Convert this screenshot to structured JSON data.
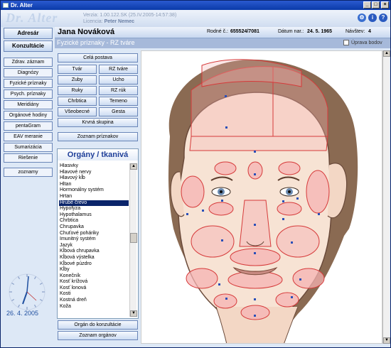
{
  "window": {
    "title": "Dr. Alter"
  },
  "header": {
    "logo": "Dr. Alter",
    "version": "Verzia: 1.00.122.SK (25.IV.2005-14:57:38)",
    "license_label": "Licencia:",
    "license_name": "Peter Nemec"
  },
  "sidebar": {
    "buttons": [
      "Adresár",
      "Konzultácie"
    ],
    "items": [
      "Zdrav. záznam",
      "Diagnózy",
      "Fyzické príznaky",
      "Psych. príznaky",
      "Meridiány",
      "Orgánové hodiny",
      "pentaGram",
      "EAV meranie",
      "Sumarizácia",
      "Riešenie"
    ],
    "notes": "zoznamy",
    "date": "26. 4. 2005"
  },
  "patient": {
    "name": "Jana Nováková",
    "rc_label": "Rodné č.:",
    "rc": "655524/7081",
    "dob_label": "Dátum nar.:",
    "dob": "24. 5. 1965",
    "visit_label": "Návštev:",
    "visits": "4"
  },
  "view": {
    "title": "Fyzické príznaky - RZ tváre",
    "edit_checkbox": "Úprava bodov"
  },
  "body_parts": {
    "whole": "Celá postava",
    "grid": [
      "Tvár",
      "RZ tváre",
      "Zuby",
      "Ucho",
      "Ruky",
      "RZ rúk",
      "Chrbtica",
      "Temeno",
      "Všeobecné",
      "Gesta"
    ],
    "blood": "Krvná skupina",
    "symptoms_list": "Zoznam príznakov"
  },
  "organs": {
    "heading": "Orgány / tkanivá",
    "items": [
      "Hlasivky",
      "Hlavové nervy",
      "Hlavový kĺb",
      "Hltan",
      "Hormonálny systém",
      "Hrtan",
      "Hrubé črevo",
      "Hypofýza",
      "Hypothalamus",
      "Chrbtica",
      "Chrupavka",
      "Chuťové poháriky",
      "Imunitný systém",
      "Jazyk",
      "Kĺbová chrupavka",
      "Kĺbová výstelka",
      "Kĺbové púzdro",
      "Kĺby",
      "Konečník",
      "Kosť krížová",
      "Kosť lonová",
      "Kosti",
      "Kostná dreň",
      "Koža"
    ],
    "selected_index": 6,
    "buttons": [
      "Orgán do konzultácie",
      "Zoznam orgánov"
    ]
  },
  "colors": {
    "accent": "#0a246a",
    "zone_fill": "#f5b3b3",
    "zone_stroke": "#d63a3a",
    "hair": "#8a6a52"
  }
}
